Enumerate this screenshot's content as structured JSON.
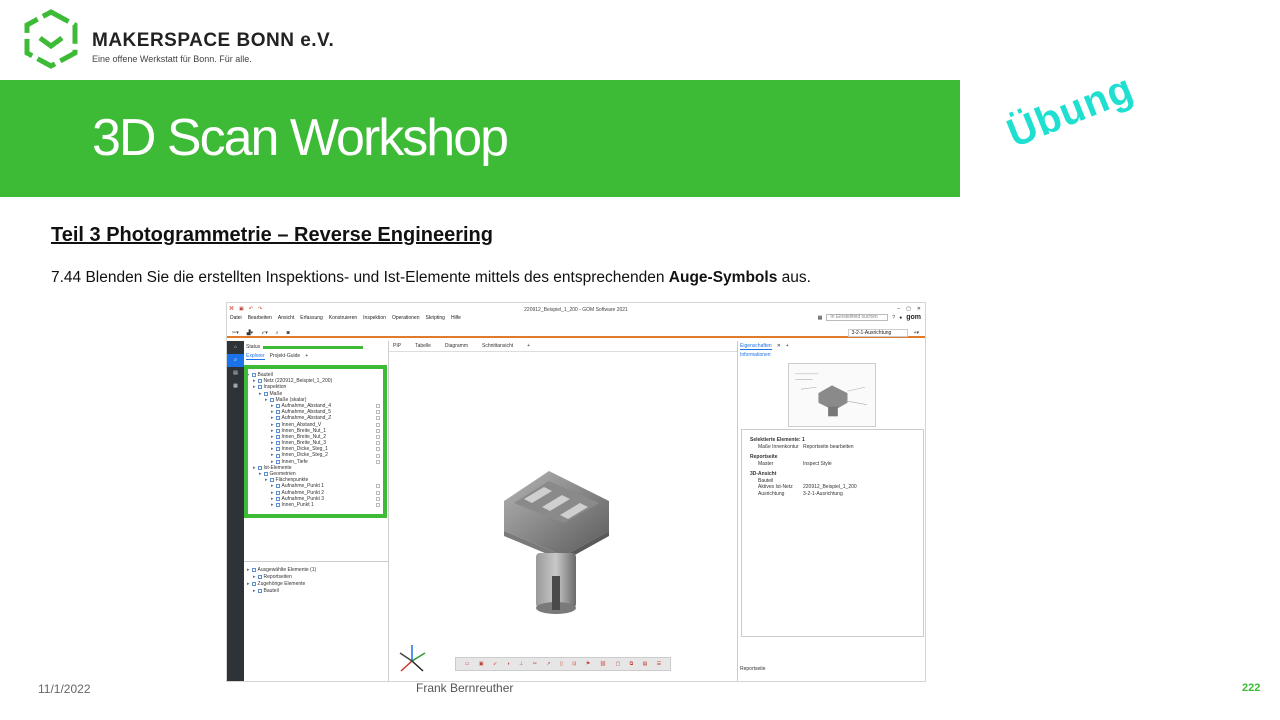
{
  "slide": {
    "org_name": "MAKERSPACE BONN e.V.",
    "org_tagline": "Eine offene Werkstatt für Bonn. Für alle.",
    "title": "3D Scan Workshop",
    "badge": "Übung",
    "section": "Teil 3  Photogrammetrie  – Reverse Engineering",
    "instruction_prefix": "7.44 Blenden Sie die erstellten Inspektions- und Ist-Elemente mittels des entsprechenden ",
    "instruction_bold": "Auge-Symbols",
    "instruction_suffix": " aus.",
    "footer_date": "11/1/2022",
    "footer_author": "Frank Bernreuther",
    "page_number": "222",
    "colors": {
      "brand_green": "#3dbb37",
      "accent_cyan": "#1fe0d0",
      "toolbar_orange": "#e07a2d",
      "selection_blue": "#1a73e8"
    }
  },
  "app": {
    "window_title": "220912_Beispiel_1_200 - GOM Software 2021",
    "menu": [
      "Datei",
      "Bearbeiten",
      "Ansicht",
      "Erfassung",
      "Konstruieren",
      "Inspektion",
      "Operationen",
      "Skripting",
      "Hilfe"
    ],
    "search_placeholder": "In Einstellfeld suchen",
    "brand": "gom",
    "alignment": "3-2-1-Ausrichtung",
    "left_panel": {
      "status_label": "Status",
      "tabs": [
        "Explorer",
        "Projekt-Guide"
      ],
      "tree": [
        {
          "label": "Bauteil",
          "indent": 0
        },
        {
          "label": "Netz (220912_Beispiel_1_200)",
          "indent": 1
        },
        {
          "label": "Inspektion",
          "indent": 1
        },
        {
          "label": "Maße",
          "indent": 2
        },
        {
          "label": "Maße (skalar)",
          "indent": 3
        },
        {
          "label": "Aufnahme_Abstand_4",
          "indent": 4
        },
        {
          "label": "Aufnahme_Abstand_5",
          "indent": 4
        },
        {
          "label": "Aufnahme_Abstand_Z",
          "indent": 4
        },
        {
          "label": "Innen_Abstand_V",
          "indent": 4
        },
        {
          "label": "Innen_Breite_Nut_1",
          "indent": 4
        },
        {
          "label": "Innen_Breite_Nut_2",
          "indent": 4
        },
        {
          "label": "Innen_Breite_Nut_3",
          "indent": 4
        },
        {
          "label": "Innen_Dicke_Steg_1",
          "indent": 4
        },
        {
          "label": "Innen_Dicke_Steg_2",
          "indent": 4
        },
        {
          "label": "Innen_Tiefe",
          "indent": 4
        },
        {
          "label": "Ist-Elemente",
          "indent": 1
        },
        {
          "label": "Geometrien",
          "indent": 2
        },
        {
          "label": "Flächenpunkte",
          "indent": 3
        },
        {
          "label": "Aufnahme_Punkt 1",
          "indent": 4
        },
        {
          "label": "Aufnahme_Punkt 2",
          "indent": 4
        },
        {
          "label": "Aufnahme_Punkt 3",
          "indent": 4
        },
        {
          "label": "Innen_Punkt 1",
          "indent": 4
        }
      ],
      "selection_tree": [
        {
          "label": "Ausgewählte Elemente (1)",
          "indent": 0
        },
        {
          "label": "Reportseiten",
          "indent": 1
        },
        {
          "label": "Zugehörige Elemente",
          "indent": 0
        },
        {
          "label": "Bauteil",
          "indent": 1
        }
      ]
    },
    "viewport_tabs": [
      "PIP",
      "Tabelle",
      "Diagramm",
      "Schnittansicht"
    ],
    "properties": {
      "tabs": [
        "Eigenschaften"
      ],
      "info": "Informationen",
      "rows": [
        {
          "section": "Selektierte Elemente: 1"
        },
        {
          "key": "Maße Innenkontur",
          "value": "Reportseite bearbeiten"
        },
        {
          "section": "Reportseite"
        },
        {
          "key": "Master",
          "value": "Inspect Style"
        },
        {
          "section": "3D-Ansicht"
        },
        {
          "key": "Bauteil",
          "value": ""
        },
        {
          "key": "Aktives Ist-Netz",
          "value": "220912_Beispiel_1_200"
        },
        {
          "key": "Ausrichtung",
          "value": "3-2-1-Ausrichtung"
        }
      ],
      "bottom_label": "Reportseite"
    }
  }
}
